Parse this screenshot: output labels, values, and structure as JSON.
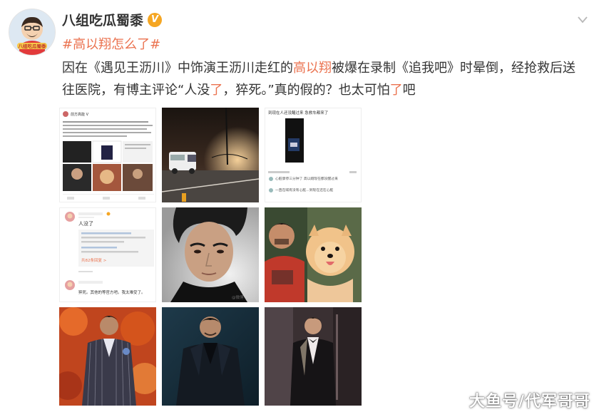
{
  "post": {
    "username": "八组吃瓜蜀黍",
    "verified_badge": "V",
    "avatar_text": "八组吃瓜蜀黍",
    "hashtag": "#高以翔怎么了#",
    "text_parts": [
      "因在《遇见王沥川》中饰演王沥川走红的",
      "高以翔",
      "被爆在录制《追我吧》时晕倒，经抢救后送往医院，有博主评论“人没",
      "了",
      "，猝死。”真的假的？也太可怕",
      "了",
      "吧"
    ]
  },
  "thumbnails": {
    "screenshot_header": "前方高能 V",
    "comment_top": "人没了",
    "comment_bottom": "猝死。其他的等官方吧。我太难受了。",
    "replies_link": "共82条回复 >",
    "chat_title": "到现在人还没醒过来 急救车都来了",
    "chat_line_1": "心脏骤停三分钟了 高以翔现在都没醒过来",
    "chat_line_2": "一直在喊有没有心脏...到现在还在心脏",
    "img_watermark": "@微博"
  },
  "watermark": "大鱼号/代军哥哥",
  "colors": {
    "link": "#eb7350",
    "text": "#333333",
    "badge": "#f5a623"
  },
  "icons": {
    "chevron": "chevron-down-icon",
    "verified": "verified-v-icon"
  }
}
